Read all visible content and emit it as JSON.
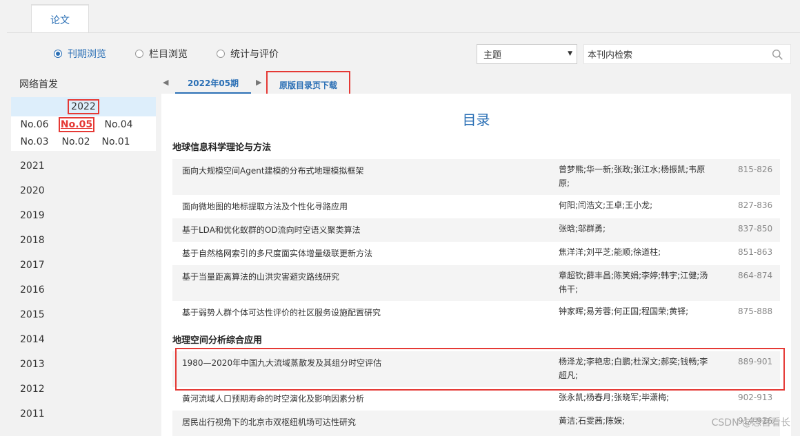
{
  "tabs": {
    "paper": "论文"
  },
  "browse": {
    "options": [
      "刊期浏览",
      "栏目浏览",
      "统计与评价"
    ],
    "selected_index": 0
  },
  "search": {
    "select_value": "主题",
    "input_value": "本刊内检索"
  },
  "left": {
    "header": "网络首发",
    "current_year": "2022",
    "issues": [
      "No.06",
      "No.05",
      "No.04",
      "No.03",
      "No.02",
      "No.01"
    ],
    "selected_issue": "No.05",
    "years": [
      "2021",
      "2020",
      "2019",
      "2018",
      "2017",
      "2016",
      "2015",
      "2014",
      "2013",
      "2012",
      "2011"
    ]
  },
  "issue_tabs": {
    "current": "2022年05期",
    "download": "原版目录页下载"
  },
  "toc": {
    "title": "目录",
    "sections": [
      {
        "name": "地球信息科学理论与方法",
        "rows": [
          {
            "title": "面向大规模空间Agent建模的分布式地理模拟框架",
            "authors": "曾梦熊;华一新;张政;张江水;杨振凯;韦原原;",
            "pages": "815-826"
          },
          {
            "title": "面向微地图的地标提取方法及个性化寻路应用",
            "authors": "何阳;闫浩文;王卓;王小龙;",
            "pages": "827-836"
          },
          {
            "title": "基于LDA和优化蚁群的OD流向时空语义聚类算法",
            "authors": "张晗;邬群勇;",
            "pages": "837-850"
          },
          {
            "title": "基于自然格网索引的多尺度面实体增量级联更新方法",
            "authors": "焦洋洋;刘平芝;能顺;徐道柱;",
            "pages": "851-863"
          },
          {
            "title": "基于当量距离算法的山洪灾害避灾路线研究",
            "authors": "章超钦;薛丰昌;陈笑娟;李婷;韩宇;江健;汤伟干;",
            "pages": "864-874"
          },
          {
            "title": "基于弱势人群个体可达性评价的社区服务设施配置研究",
            "authors": "钟家晖;易芳蓉;何正国;程国荣;黄铎;",
            "pages": "875-888"
          }
        ]
      },
      {
        "name": "地理空间分析综合应用",
        "rows": [
          {
            "title": "1980—2020年中国九大流域蒸散发及其组分时空评估",
            "authors": "杨泽龙;李艳忠;白鹏;杜深文;郝奕;钱畅;李超凡;",
            "pages": "889-901"
          },
          {
            "title": "黄河流域人口预期寿命的时空演化及影响因素分析",
            "authors": "张永凯;杨春月;张晓军;毕潇梅;",
            "pages": "902-913"
          },
          {
            "title": "居民出行视角下的北京市双枢纽机场可达性研究",
            "authors": "黄洁;石雯茜;陈娱;",
            "pages": "914-926"
          }
        ]
      }
    ]
  },
  "watermark": "CSDN @思音看长"
}
